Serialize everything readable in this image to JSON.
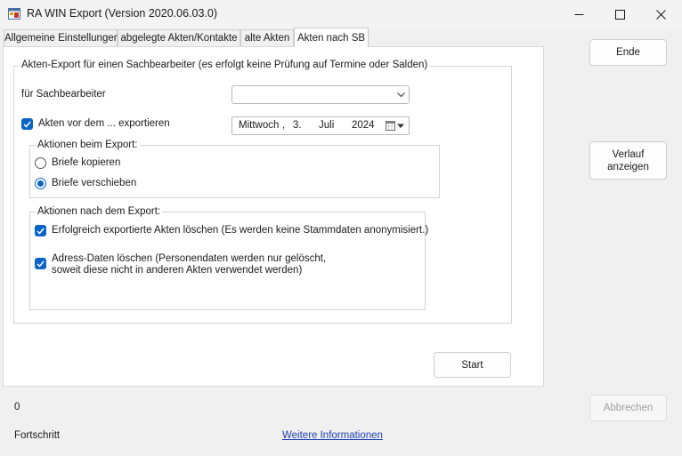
{
  "window": {
    "title": "RA WIN Export (Version 2020.06.03.0)"
  },
  "tabs": [
    {
      "label": "Allgemeine Einstellungen",
      "active": false
    },
    {
      "label": "abgelegte Akten/Kontakte",
      "active": false
    },
    {
      "label": "alte Akten",
      "active": false
    },
    {
      "label": "Akten nach SB",
      "active": true
    }
  ],
  "main_group": {
    "title": "Akten-Export für einen Sachbearbeiter (es erfolgt keine Prüfung auf Termine oder Salden)",
    "sachbearbeiter_label": "für Sachbearbeiter",
    "sachbearbeiter_value": "",
    "before_date": {
      "label": "Akten vor dem ... exportieren",
      "checked": true,
      "weekday": "Mittwoch",
      "sep1": ",",
      "day": "3.",
      "month": "Juli",
      "year": "2024"
    },
    "export_actions": {
      "title": "Aktionen beim Export:",
      "options": [
        {
          "label": "Briefe kopieren",
          "selected": false
        },
        {
          "label": "Briefe verschieben",
          "selected": true
        }
      ]
    },
    "post_actions": {
      "title": "Aktionen nach dem Export:",
      "delete_files": {
        "label": "Erfolgreich exportierte Akten löschen (Es werden keine Stammdaten anonymisiert.)",
        "checked": true
      },
      "delete_address": {
        "line1": "Adress-Daten löschen (Personendaten werden nur gelöscht,",
        "line2": "soweit diese nicht in anderen Akten verwendet werden)",
        "checked": true
      }
    }
  },
  "buttons": {
    "start": "Start",
    "ende": "Ende",
    "verlauf_line1": "Verlauf",
    "verlauf_line2": "anzeigen",
    "abbrechen": "Abbrechen"
  },
  "footer": {
    "progress_value": "0",
    "progress_label": "Fortschritt",
    "info_link": "Weitere Informationen"
  },
  "icons": {
    "app": "app-window-icon",
    "minimize": "minimize-icon",
    "maximize": "maximize-icon",
    "close": "close-icon",
    "dropdown": "chevron-down-icon",
    "calendar": "calendar-icon",
    "check": "checkmark-icon"
  },
  "colors": {
    "accent": "#0a64c8",
    "link": "#1f3fb4"
  }
}
